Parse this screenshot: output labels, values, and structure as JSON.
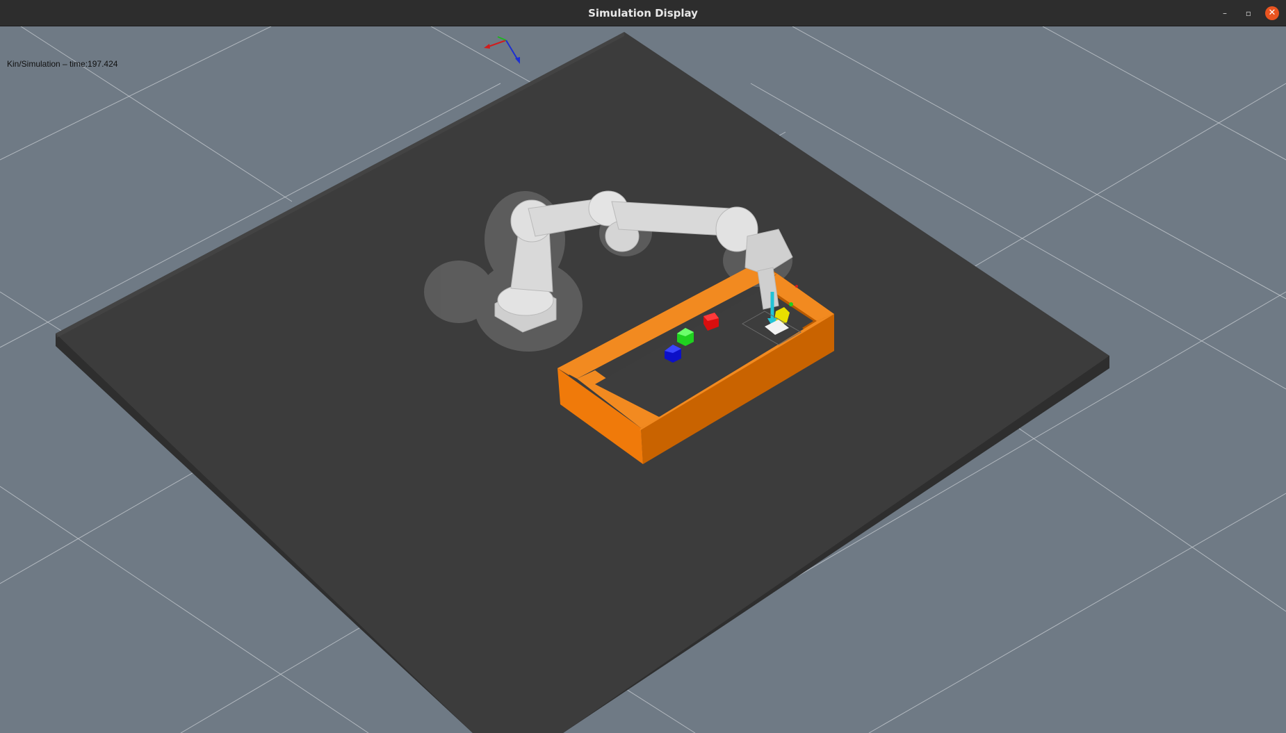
{
  "window": {
    "title": "Simulation Display",
    "controls": {
      "minimize": "–",
      "maximize": "▫",
      "close": "✕"
    }
  },
  "viewport": {
    "status_text": "Kin/Simulation – time:197.424",
    "background_color": "#6f7a85",
    "floor_color": "#3c3c3c",
    "tray_color": "#f07a0a"
  },
  "scene": {
    "objects": [
      {
        "name": "robot-arm",
        "color": "#d9d9d9"
      },
      {
        "name": "tray",
        "color": "#f07a0a"
      },
      {
        "name": "cube-red",
        "color": "#d80e0e"
      },
      {
        "name": "cube-green",
        "color": "#1fd11f"
      },
      {
        "name": "cube-blue",
        "color": "#0c10c8"
      },
      {
        "name": "cube-yellow",
        "color": "#e8e000"
      }
    ]
  }
}
